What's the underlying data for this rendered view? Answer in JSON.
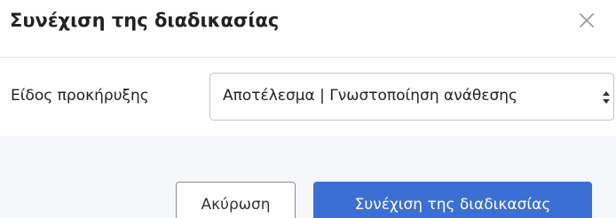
{
  "dialog": {
    "title": "Συνέχιση της διαδικασίας",
    "close_icon": "close-icon"
  },
  "form": {
    "notice_type_label": "Είδος προκήρυξης",
    "notice_type_selected": "Αποτέλεσμα | Γνωστοποίηση ανάθεσης",
    "select_arrow_icon": "select-updown-arrow-icon"
  },
  "footer": {
    "cancel_label": "Ακύρωση",
    "continue_label": "Συνέχιση της διαδικασίας"
  },
  "colors": {
    "primary": "#3c6fd4",
    "footer_background": "#f5f7fa",
    "border": "#c4c4c4"
  }
}
